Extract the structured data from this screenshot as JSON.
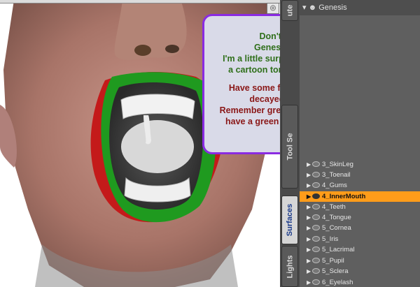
{
  "callout": {
    "green_lines": [
      "Don't forget in here!",
      "Genesis has tonsils!!!!",
      "I'm a little surprized nobody has done",
      "a cartoon tonsil scream morph yet."
    ],
    "red_lines": [
      "Have some fun, make a gold tooth,",
      "decayed teeth, whatever.",
      "Remember green blooded aliens would",
      "have a green mouth, not bright pink."
    ]
  },
  "tabs": {
    "top": "ute",
    "tool_settings": "Tool Se",
    "surfaces": "Surfaces",
    "lights": "Lights"
  },
  "panel": {
    "header": "Genesis",
    "items": [
      "3_SkinLeg",
      "3_Toenail",
      "4_Gums",
      "4_InnerMouth",
      "4_Teeth",
      "4_Tongue",
      "5_Cornea",
      "5_Iris",
      "5_Lacrimal",
      "5_Pupil",
      "5_Sclera",
      "6_Eyelash"
    ],
    "selected": "4_InnerMouth"
  },
  "colors": {
    "selection": "#ff9c1a",
    "callout_border": "#8a2be2",
    "green_text": "#2f6f1a",
    "red_text": "#8a1717",
    "lip_green": "#1f9a1f",
    "mouth_red": "#c41a1a"
  }
}
